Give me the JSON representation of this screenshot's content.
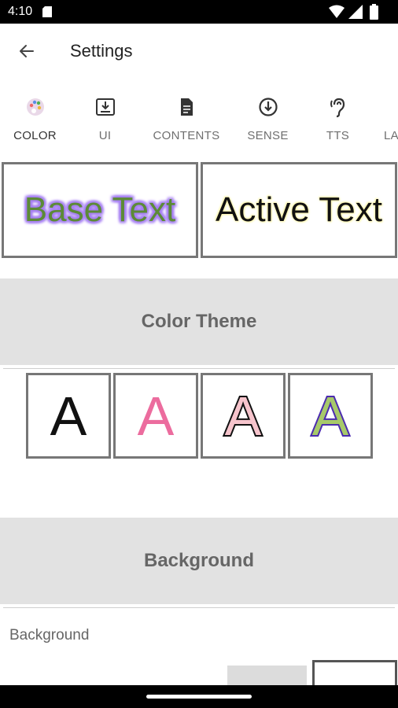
{
  "status_bar": {
    "time": "4:10"
  },
  "app_bar": {
    "title": "Settings"
  },
  "tabs": [
    {
      "label": "COLOR",
      "icon": "palette-icon",
      "active": true
    },
    {
      "label": "UI",
      "icon": "download-box-icon",
      "active": false
    },
    {
      "label": "CONTENTS",
      "icon": "document-icon",
      "active": false
    },
    {
      "label": "SENSE",
      "icon": "arrow-down-circle-icon",
      "active": false
    },
    {
      "label": "TTS",
      "icon": "hearing-icon",
      "active": false
    },
    {
      "label": "LA",
      "icon": "",
      "active": false
    }
  ],
  "samples": {
    "base_text": "Base Text",
    "active_text": "Active Text",
    "base_text_color": "#5c8a37",
    "base_text_glow": "#a57ef2",
    "active_text_color": "#111111",
    "active_text_glow": "#fff8b0"
  },
  "color_theme": {
    "header": "Color Theme",
    "themes": [
      {
        "glyph": "A",
        "fill": "#111111",
        "outline": ""
      },
      {
        "glyph": "A",
        "fill": "#ec6c9e",
        "outline": ""
      },
      {
        "glyph": "A",
        "fill": "#f6c4cc",
        "outline": "#111111"
      },
      {
        "glyph": "A",
        "fill": "#a7c96a",
        "outline": "#4b2bb0"
      }
    ]
  },
  "background": {
    "header": "Background",
    "label": "Background"
  }
}
